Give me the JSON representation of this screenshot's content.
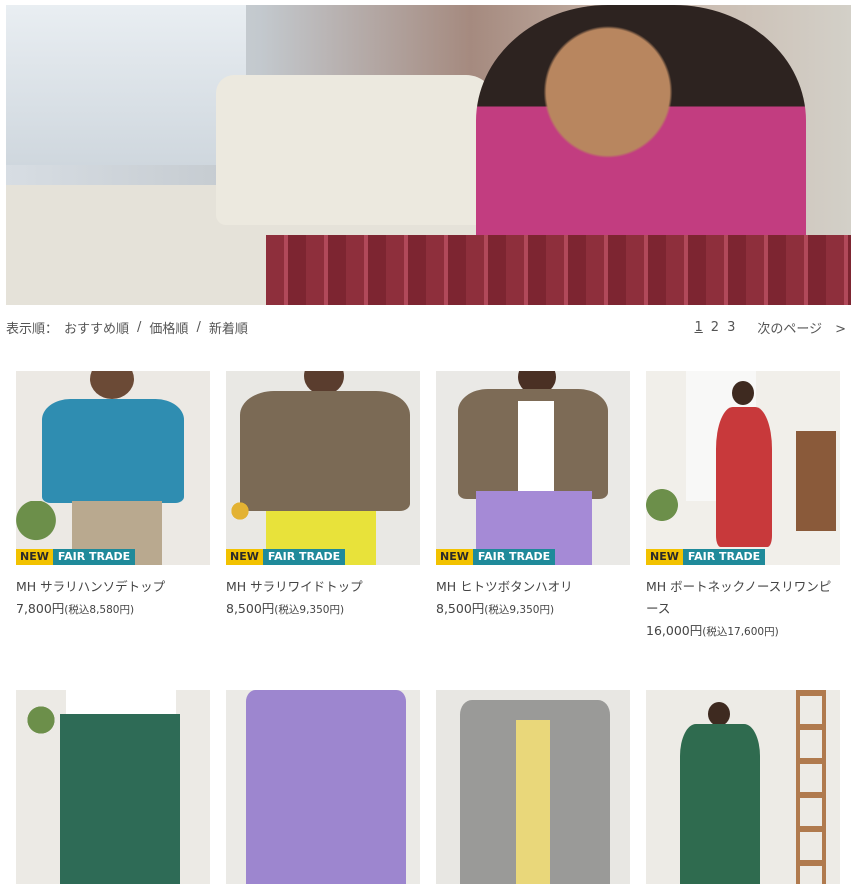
{
  "sort": {
    "prefix": "表示順：",
    "options": [
      "おすすめ順",
      "価格順",
      "新着順"
    ],
    "separator": "/"
  },
  "pager": {
    "pages": [
      "1",
      "2",
      "3"
    ],
    "current": "1",
    "next_label": "次のページ　>"
  },
  "badges": {
    "new": "NEW",
    "fair_trade": "FAIR TRADE"
  },
  "products": [
    {
      "name": "MH サラリハンソデトップ",
      "price": "7,800円",
      "tax": "(税込8,580円)",
      "top_color": "#2f8db1",
      "bottom_color": "#b9a98f",
      "bg": "#ece9e4"
    },
    {
      "name": "MH サラリワイドトップ",
      "price": "8,500円",
      "tax": "(税込9,350円)",
      "top_color": "#7b6a55",
      "bottom_color": "#e8e23a",
      "bg": "#e9e8e4"
    },
    {
      "name": "MH ヒトツボタンハオリ",
      "price": "8,500円",
      "tax": "(税込9,350円)",
      "top_color": "#7d6b56",
      "bottom_color": "#a58ad6",
      "bg": "#eae9e6"
    },
    {
      "name": "MH ボートネックノースリワンピース",
      "price": "16,000円",
      "tax": "(税込17,600円)",
      "top_color": "#c8393b",
      "bottom_color": "#c8393b",
      "bg": "#f1efea"
    },
    {
      "name": "",
      "price": "",
      "tax": "",
      "top_color": "#f2f2f2",
      "bottom_color": "#2e6b56",
      "bg": "#eceae5"
    },
    {
      "name": "",
      "price": "",
      "tax": "",
      "top_color": "#9d86cf",
      "bottom_color": "#9d86cf",
      "bg": "#ebeae6"
    },
    {
      "name": "",
      "price": "",
      "tax": "",
      "top_color": "#9a9a98",
      "bottom_color": "#e9d77a",
      "bg": "#e8e7e3"
    },
    {
      "name": "",
      "price": "",
      "tax": "",
      "top_color": "#2f6b4f",
      "bottom_color": "#2f6b4f",
      "bg": "#edebe6"
    }
  ]
}
